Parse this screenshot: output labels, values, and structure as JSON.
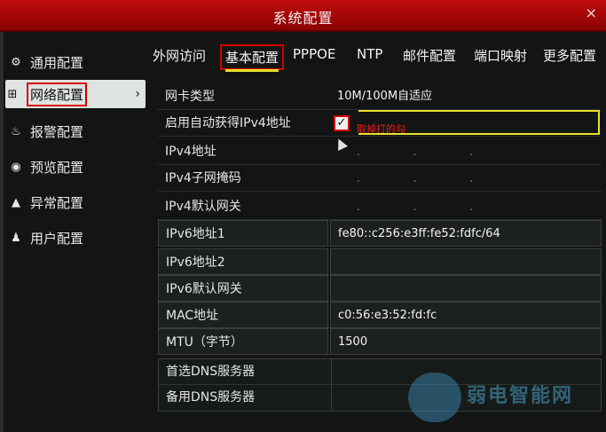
{
  "window": {
    "title": "系统配置",
    "close_label": "×"
  },
  "sidebar": {
    "items": [
      {
        "label": "通用配置",
        "icon": "gear-icon",
        "glyph": "⚙"
      },
      {
        "label": "网络配置",
        "icon": "network-icon",
        "glyph": "⊞",
        "active": true
      },
      {
        "label": "报警配置",
        "icon": "bell-icon",
        "glyph": "♨"
      },
      {
        "label": "预览配置",
        "icon": "eye-icon",
        "glyph": "◉"
      },
      {
        "label": "异常配置",
        "icon": "warning-icon",
        "glyph": "▲"
      },
      {
        "label": "用户配置",
        "icon": "users-icon",
        "glyph": "♟"
      }
    ],
    "arrow": "›"
  },
  "tabs": [
    {
      "label": "外网访问"
    },
    {
      "label": "基本配置",
      "active": true
    },
    {
      "label": "PPPOE"
    },
    {
      "label": "NTP"
    },
    {
      "label": "邮件配置"
    },
    {
      "label": "端口映射"
    },
    {
      "label": "更多配置"
    }
  ],
  "form": {
    "nic_type": {
      "label": "网卡类型",
      "value": "10M/100M自适应"
    },
    "dhcp": {
      "label": "启用自动获得IPv4地址",
      "checked": true,
      "check_glyph": "✓",
      "annotation": "取掉打的勾"
    },
    "ipv4_addr": {
      "label": "IPv4地址",
      "value": ".        .        ."
    },
    "ipv4_mask": {
      "label": "IPv4子网掩码",
      "value": ".        .        ."
    },
    "ipv4_gw": {
      "label": "IPv4默认网关",
      "value": ".        .        ."
    },
    "ipv6_addr1": {
      "label": "IPv6地址1",
      "value": "fe80::c256:e3ff:fe52:fdfc/64"
    },
    "ipv6_addr2": {
      "label": "IPv6地址2",
      "value": ""
    },
    "ipv6_gw": {
      "label": "IPv6默认网关",
      "value": ""
    },
    "mac": {
      "label": "MAC地址",
      "value": "c0:56:e3:52:fd:fc"
    },
    "mtu": {
      "label": "MTU（字节）",
      "value": "1500"
    },
    "dns1": {
      "label": "首选DNS服务器",
      "value": ""
    },
    "dns2": {
      "label": "备用DNS服务器",
      "value": ""
    }
  },
  "watermark": {
    "text": "弱电智能网"
  }
}
